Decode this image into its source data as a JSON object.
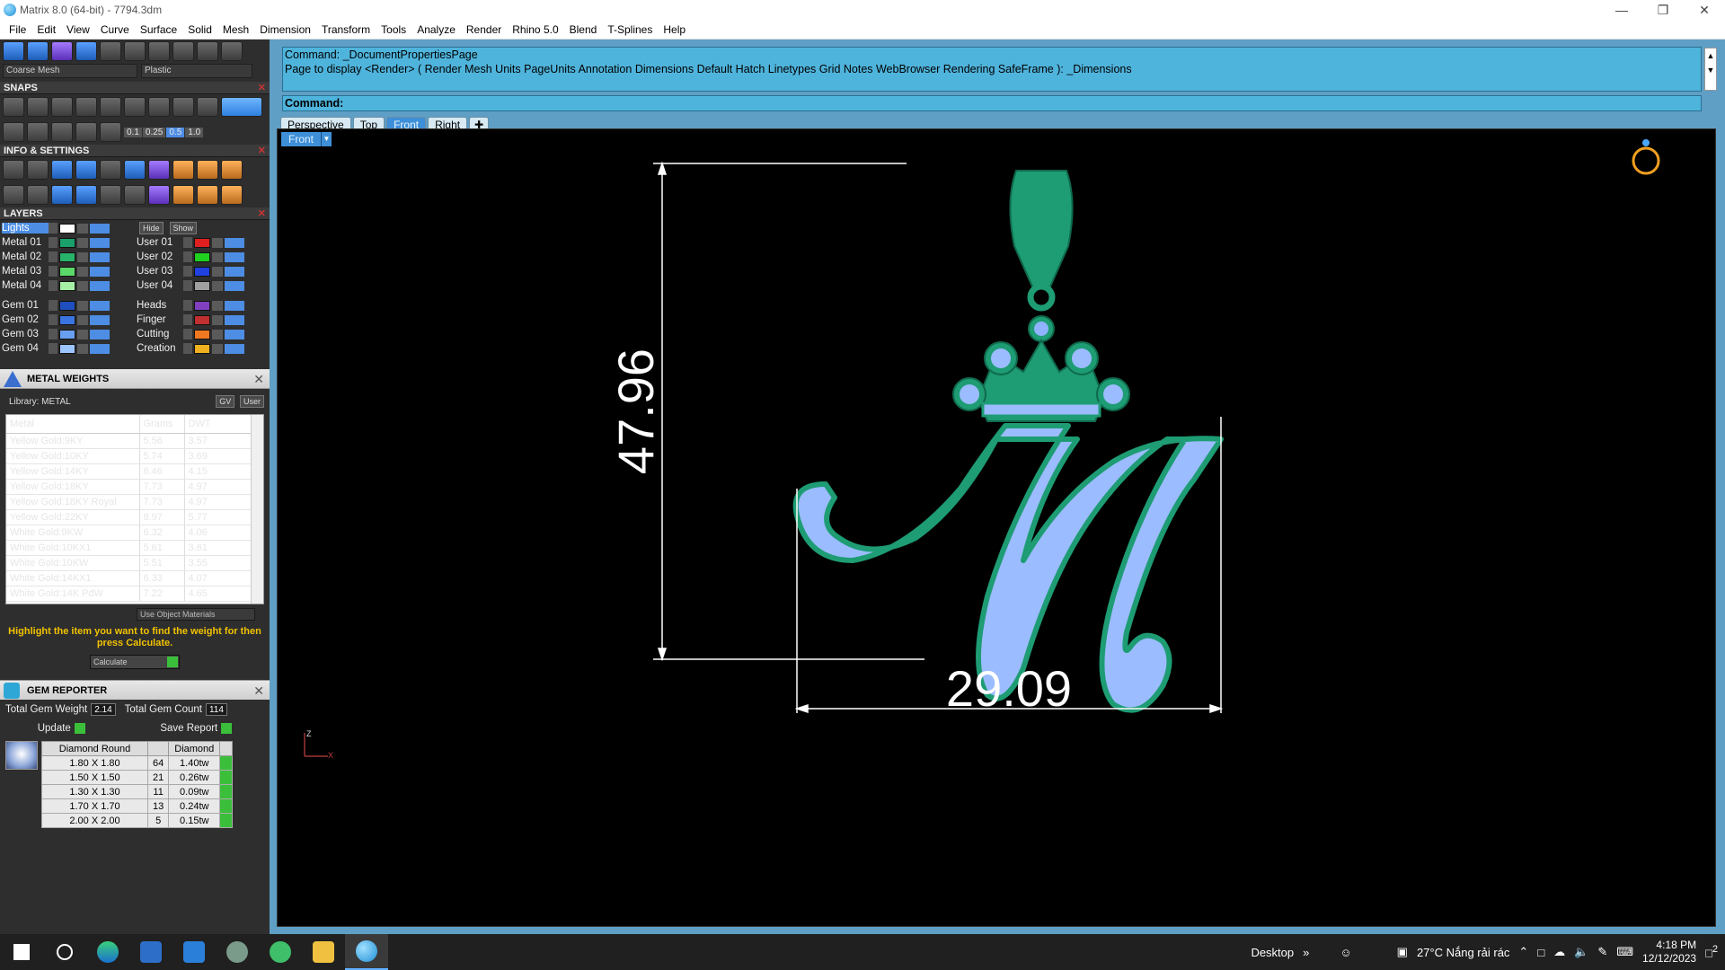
{
  "window": {
    "title": "Matrix 8.0 (64-bit) - 7794.3dm"
  },
  "menus": [
    "File",
    "Edit",
    "View",
    "Curve",
    "Surface",
    "Solid",
    "Mesh",
    "Dimension",
    "Transform",
    "Tools",
    "Analyze",
    "Render",
    "Rhino 5.0",
    "Blend",
    "T-Splines",
    "Help"
  ],
  "toolbar_top": {
    "mesh_combo": "Coarse Mesh",
    "material_combo": "Plastic"
  },
  "snaps": {
    "title": "SNAPS",
    "scale_values": [
      "0.1",
      "0.25",
      "0.5",
      "1.0"
    ]
  },
  "info_settings": {
    "title": "INFO & SETTINGS"
  },
  "layers": {
    "title": "LAYERS",
    "hide_label": "Hide",
    "show_label": "Show",
    "left": [
      {
        "name": "Lights",
        "color": "#ffffff"
      },
      {
        "name": "Metal 01",
        "color": "#1aa06a"
      },
      {
        "name": "Metal 02",
        "color": "#27b36a"
      },
      {
        "name": "Metal 03",
        "color": "#5ad86a"
      },
      {
        "name": "Metal 04",
        "color": "#a6f0a6"
      },
      {
        "name": "Gem 01",
        "color": "#1f4fbf"
      },
      {
        "name": "Gem 02",
        "color": "#3a74e0"
      },
      {
        "name": "Gem 03",
        "color": "#6a9ef0"
      },
      {
        "name": "Gem 04",
        "color": "#9cc4ff"
      }
    ],
    "right": [
      {
        "name": "User 01",
        "color": "#e02020"
      },
      {
        "name": "User 02",
        "color": "#20d020"
      },
      {
        "name": "User 03",
        "color": "#2040e0"
      },
      {
        "name": "User 04",
        "color": "#a0a0a0"
      },
      {
        "name": "Heads",
        "color": "#8040c0"
      },
      {
        "name": "Finger",
        "color": "#c03030"
      },
      {
        "name": "Cutting",
        "color": "#f07820"
      },
      {
        "name": "Creation",
        "color": "#f0b020"
      }
    ]
  },
  "metal_weights": {
    "title": "METAL WEIGHTS",
    "library_label": "Library: METAL",
    "gv_label": "GV",
    "user_label": "User",
    "columns": [
      "Metal",
      "Grams",
      "DWT"
    ],
    "rows": [
      [
        "Yellow Gold:9KY",
        "5.56",
        "3.57"
      ],
      [
        "Yellow Gold:10KY",
        "5.74",
        "3.69"
      ],
      [
        "Yellow Gold:14KY",
        "6.46",
        "4.15"
      ],
      [
        "Yellow Gold:18KY",
        "7.73",
        "4.97"
      ],
      [
        "Yellow Gold:18KY Royal",
        "7.73",
        "4.97"
      ],
      [
        "Yellow Gold:22KY",
        "8.97",
        "5.77"
      ],
      [
        "White Gold:9KW",
        "6.32",
        "4.06"
      ],
      [
        "White Gold:10KX1",
        "5.61",
        "3.61"
      ],
      [
        "White Gold:10KW",
        "5.51",
        "3.55"
      ],
      [
        "White Gold:14KX1",
        "6.33",
        "4.07"
      ],
      [
        "White Gold:14K PdW",
        "7.22",
        "4.65"
      ]
    ],
    "use_object_materials": "Use Object Materials",
    "hint": "Highlight the item you want to find the weight for then press Calculate.",
    "calculate_label": "Calculate"
  },
  "gem_reporter": {
    "title": "GEM REPORTER",
    "total_weight_label": "Total Gem Weight",
    "total_weight": "2.14",
    "total_count_label": "Total Gem Count",
    "total_count": "114",
    "update_label": "Update",
    "save_label": "Save Report",
    "columns": [
      "Diamond Round",
      "",
      "Diamond"
    ],
    "rows": [
      [
        "1.80 X 1.80",
        "64",
        "1.40tw"
      ],
      [
        "1.50 X 1.50",
        "21",
        "0.26tw"
      ],
      [
        "1.30 X 1.30",
        "11",
        "0.09tw"
      ],
      [
        "1.70 X 1.70",
        "13",
        "0.24tw"
      ],
      [
        "2.00 X 2.00",
        "5",
        "0.15tw"
      ]
    ]
  },
  "command": {
    "line1": "Command: _DocumentPropertiesPage",
    "line2": "Page to display <Render> ( Render  Mesh  Units  PageUnits  Annotation  Dimensions  Default  Hatch  Linetypes  Grid  Notes  WebBrowser  Rendering  SafeFrame ): _Dimensions",
    "prompt": "Command:"
  },
  "view_tabs": [
    "Perspective",
    "Top",
    "Front",
    "Right"
  ],
  "active_tab": "Front",
  "viewport": {
    "label": "Front",
    "dim_height": "47.96",
    "dim_width": "29.09",
    "axis_z": "Z",
    "axis_x": "X"
  },
  "taskbar": {
    "desktop_label": "Desktop",
    "weather": "27°C  Nắng rải rác",
    "time": "4:18 PM",
    "date": "12/12/2023",
    "notification_count": "2"
  }
}
